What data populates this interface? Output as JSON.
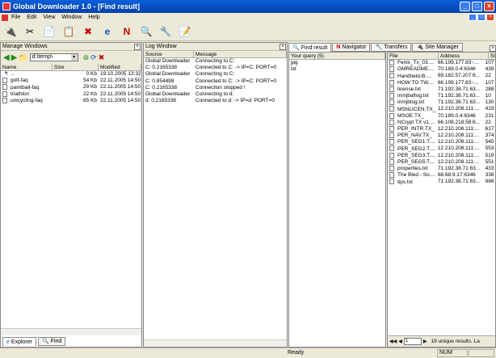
{
  "window": {
    "title": "Global Downloader 1.0 - [Find result]"
  },
  "menu": [
    "File",
    "Edit",
    "View",
    "Window",
    "Help"
  ],
  "manage": {
    "title": "Manage Windows",
    "path": "d:\\temp\\",
    "columns": [
      "Name",
      "Size",
      "Modified"
    ],
    "files": [
      {
        "name": "..",
        "size": "0 Kb",
        "modified": "19.10.2005 13:32"
      },
      {
        "name": "golf-faq",
        "size": "54 Kb",
        "modified": "22.11.2005 14:50"
      },
      {
        "name": "paintball-faq",
        "size": "29 Kb",
        "modified": "22.11.2005 14:50"
      },
      {
        "name": "triathlon",
        "size": "22 Kb",
        "modified": "22.11.2005 14:50"
      },
      {
        "name": "unicycling-faq",
        "size": "65 Kb",
        "modified": "22.11.2005 14:50"
      }
    ],
    "tabs": [
      "Explorer",
      "Find"
    ]
  },
  "log": {
    "title": "Log Window",
    "columns": [
      "Source",
      "Message"
    ],
    "rows": [
      {
        "source": "Global Downloader",
        "message": "Connecting to C:"
      },
      {
        "source": "C: 0.2165338",
        "message": "Connected to C: -> IP=C: PORT=0"
      },
      {
        "source": "Global Downloader",
        "message": "Connecting to C:"
      },
      {
        "source": "C: 0.854498",
        "message": "Connected to C: -> IP=C: PORT=0"
      },
      {
        "source": "C: 0.2165338",
        "message": "Connection stopped !"
      },
      {
        "source": "Global Downloader",
        "message": "Connecting to d:"
      },
      {
        "source": "d: 0.2165338",
        "message": "Connected to d: -> IP=d: PORT=0"
      }
    ]
  },
  "tabs": [
    "Find result",
    "Navigator",
    "Transfers",
    "Site Manager"
  ],
  "query": {
    "header": "Your query (5)",
    "items": [
      "jpg",
      "txt"
    ]
  },
  "results": {
    "columns": [
      "File",
      "Address",
      "Siz"
    ],
    "rows": [
      {
        "file": "Fenix_Tx_03....",
        "address": "66.199.177.83:-...",
        "size": "107"
      },
      {
        "file": "GMREADME....",
        "address": "70.189.0.4:6346",
        "size": "439"
      },
      {
        "file": "Handheld-B....",
        "address": "69.182.57.207:6...",
        "size": "22"
      },
      {
        "file": "HOW TO TW....",
        "address": "66.199.177.83:-...",
        "size": "107"
      },
      {
        "file": "license.txt",
        "address": "71.192.38.71:63...",
        "size": "288"
      },
      {
        "file": "mmjbaflog.txt",
        "address": "71.192.38.71:63...",
        "size": "10"
      },
      {
        "file": "mmjblog.txt",
        "address": "71.192.38.71:63...",
        "size": "130"
      },
      {
        "file": "MSNLICEN.TX_",
        "address": "12.210.208.111:...",
        "size": "419"
      },
      {
        "file": "MSOE.TX_",
        "address": "70.189.0.4:6346",
        "size": "231"
      },
      {
        "file": "NCrypt TX v1....",
        "address": "66.108.218.58:6...",
        "size": "22"
      },
      {
        "file": "PER_INTR.TX_",
        "address": "12.210.208.111:...",
        "size": "617"
      },
      {
        "file": "PER_NAV.TX_",
        "address": "12.210.208.111:...",
        "size": "374"
      },
      {
        "file": "PER_SEG1.T....",
        "address": "12.210.208.111:...",
        "size": "545"
      },
      {
        "file": "PER_SEG2.T....",
        "address": "12.210.208.111:...",
        "size": "553"
      },
      {
        "file": "PER_SEG3.T....",
        "address": "12.210.208.111:...",
        "size": "519"
      },
      {
        "file": "PER_SEG5.T....",
        "address": "12.210.208.111:...",
        "size": "551"
      },
      {
        "file": "properties.txt",
        "address": "71.192.38.71:63...",
        "size": "433"
      },
      {
        "file": "The Bled - So....",
        "address": "68.68.9.17:6346",
        "size": "338"
      },
      {
        "file": "tips.txt",
        "address": "71.192.38.71:63...",
        "size": "988"
      }
    ],
    "page": "1",
    "summary": "19 unique results. La"
  },
  "status": {
    "left": "Ready",
    "num": "NUM"
  }
}
